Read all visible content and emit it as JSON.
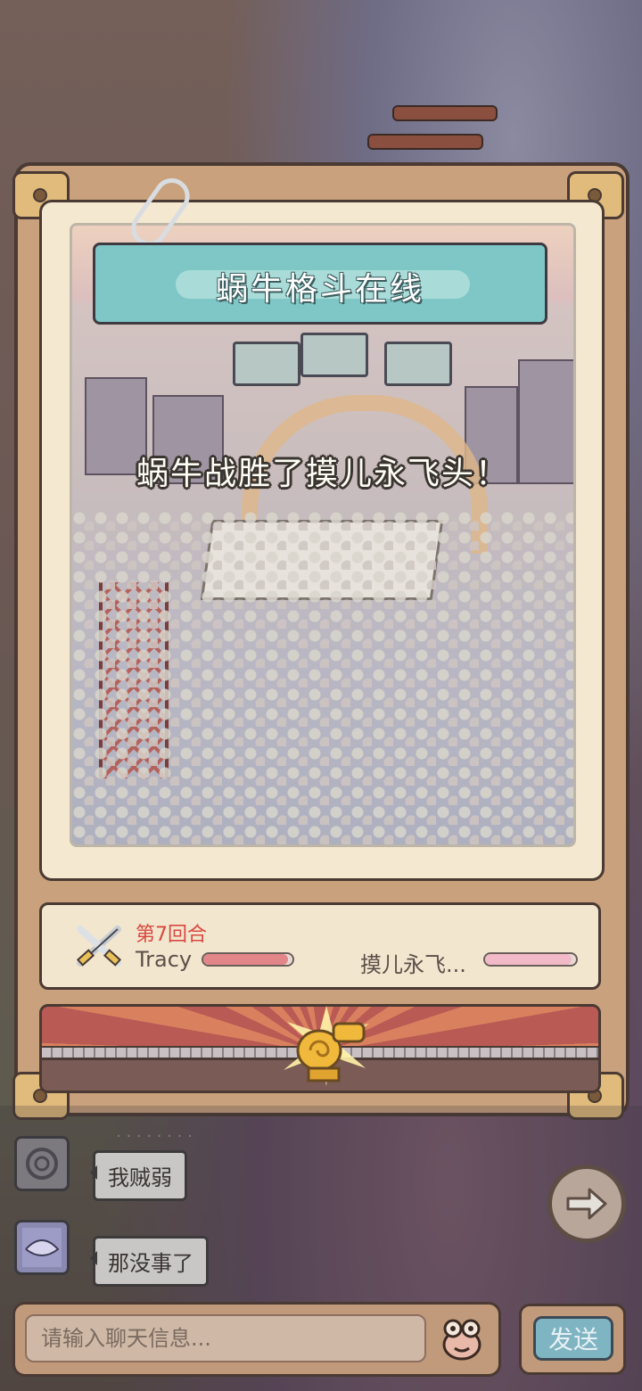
{
  "title": "蜗牛格斗在线",
  "result_message": "蜗牛战胜了摸儿永飞头！",
  "battle": {
    "round_label": "第7回合",
    "player1": {
      "name": "Tracy",
      "hp_fraction": 0.95
    },
    "player2": {
      "name": "摸儿永飞...",
      "hp_fraction": 0.95
    }
  },
  "chat": {
    "messages": [
      {
        "text": "我贼弱"
      },
      {
        "text": "那没事了"
      }
    ],
    "input_placeholder": "请输入聊天信息...",
    "send_label": "发送"
  },
  "icons": {
    "next": "arrow-right-icon",
    "emoji": "frog-emoji-icon",
    "battle": "crossed-swords-icon",
    "trophy": "golden-snail-trophy-icon",
    "clip": "paperclip-icon"
  },
  "colors": {
    "title_banner": "#7fc7c7",
    "round_text": "#d9483f",
    "hp_p1": "#e3868a",
    "hp_p2": "#f2b9c8",
    "send_button": "#7fb4c2"
  }
}
